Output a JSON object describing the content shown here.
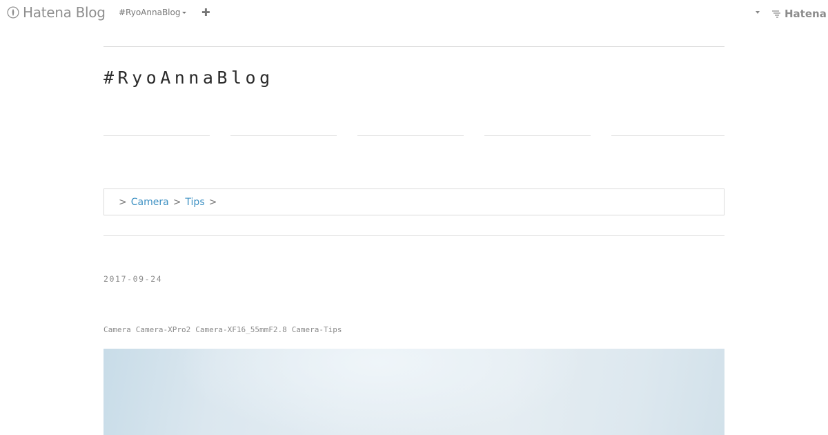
{
  "globalbar": {
    "logo_text": "Hatena Blog",
    "blog_name": "#RyoAnnaBlog",
    "add_icon": "plus-icon",
    "brand_text": "Hatena"
  },
  "header": {
    "blog_title": "#RyoAnnaBlog"
  },
  "breadcrumb": {
    "separator": ">",
    "items": [
      "Camera",
      "Tips"
    ]
  },
  "entry": {
    "date": "2017-09-24",
    "categories": [
      "Camera",
      "Camera-XPro2",
      "Camera-XF16_55mmF2.8",
      "Camera-Tips"
    ]
  },
  "colors": {
    "link": "#3b8fc2",
    "muted": "#8a8a8a",
    "rule": "#dcdcdc"
  }
}
